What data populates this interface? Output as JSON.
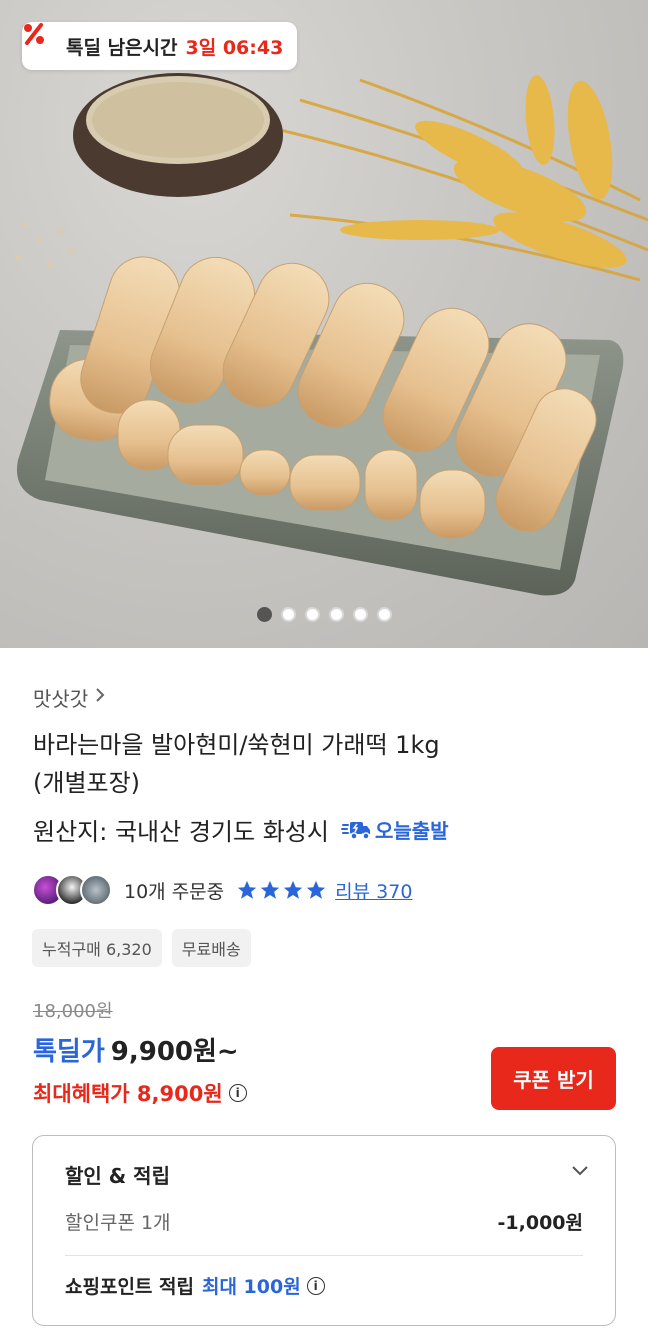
{
  "deal_timer": {
    "label": "톡딜 남은시간",
    "time": "3일 06:43"
  },
  "gallery": {
    "image_count": 6,
    "active_index": 1
  },
  "product": {
    "brand": "맛삿갓",
    "title_line1": "바라는마을 발아현미/쑥현미 가래떡 1kg",
    "title_line2": "(개별포장)",
    "origin": "원산지: 국내산 경기도 화성시",
    "shipping_badge": "오늘출발"
  },
  "stats": {
    "orders": "10개 주문중",
    "rating_stars": 4,
    "review_label": "리뷰 370"
  },
  "badges": [
    "누적구매 6,320",
    "무료배송"
  ],
  "price": {
    "original": "18,000원",
    "deal_label": "톡딜가",
    "deal_value": "9,900원~",
    "max_benefit": "최대혜택가 8,900원"
  },
  "coupon_button": "쿠폰 받기",
  "benefits": {
    "title": "할인 & 적립",
    "coupon_label": "할인쿠폰 1개",
    "coupon_value": "-1,000원",
    "point_label": "쇼핑포인트 적립",
    "point_value": "최대 100원"
  },
  "colors": {
    "accent_red": "#e8281b",
    "accent_blue": "#2a66d9"
  }
}
